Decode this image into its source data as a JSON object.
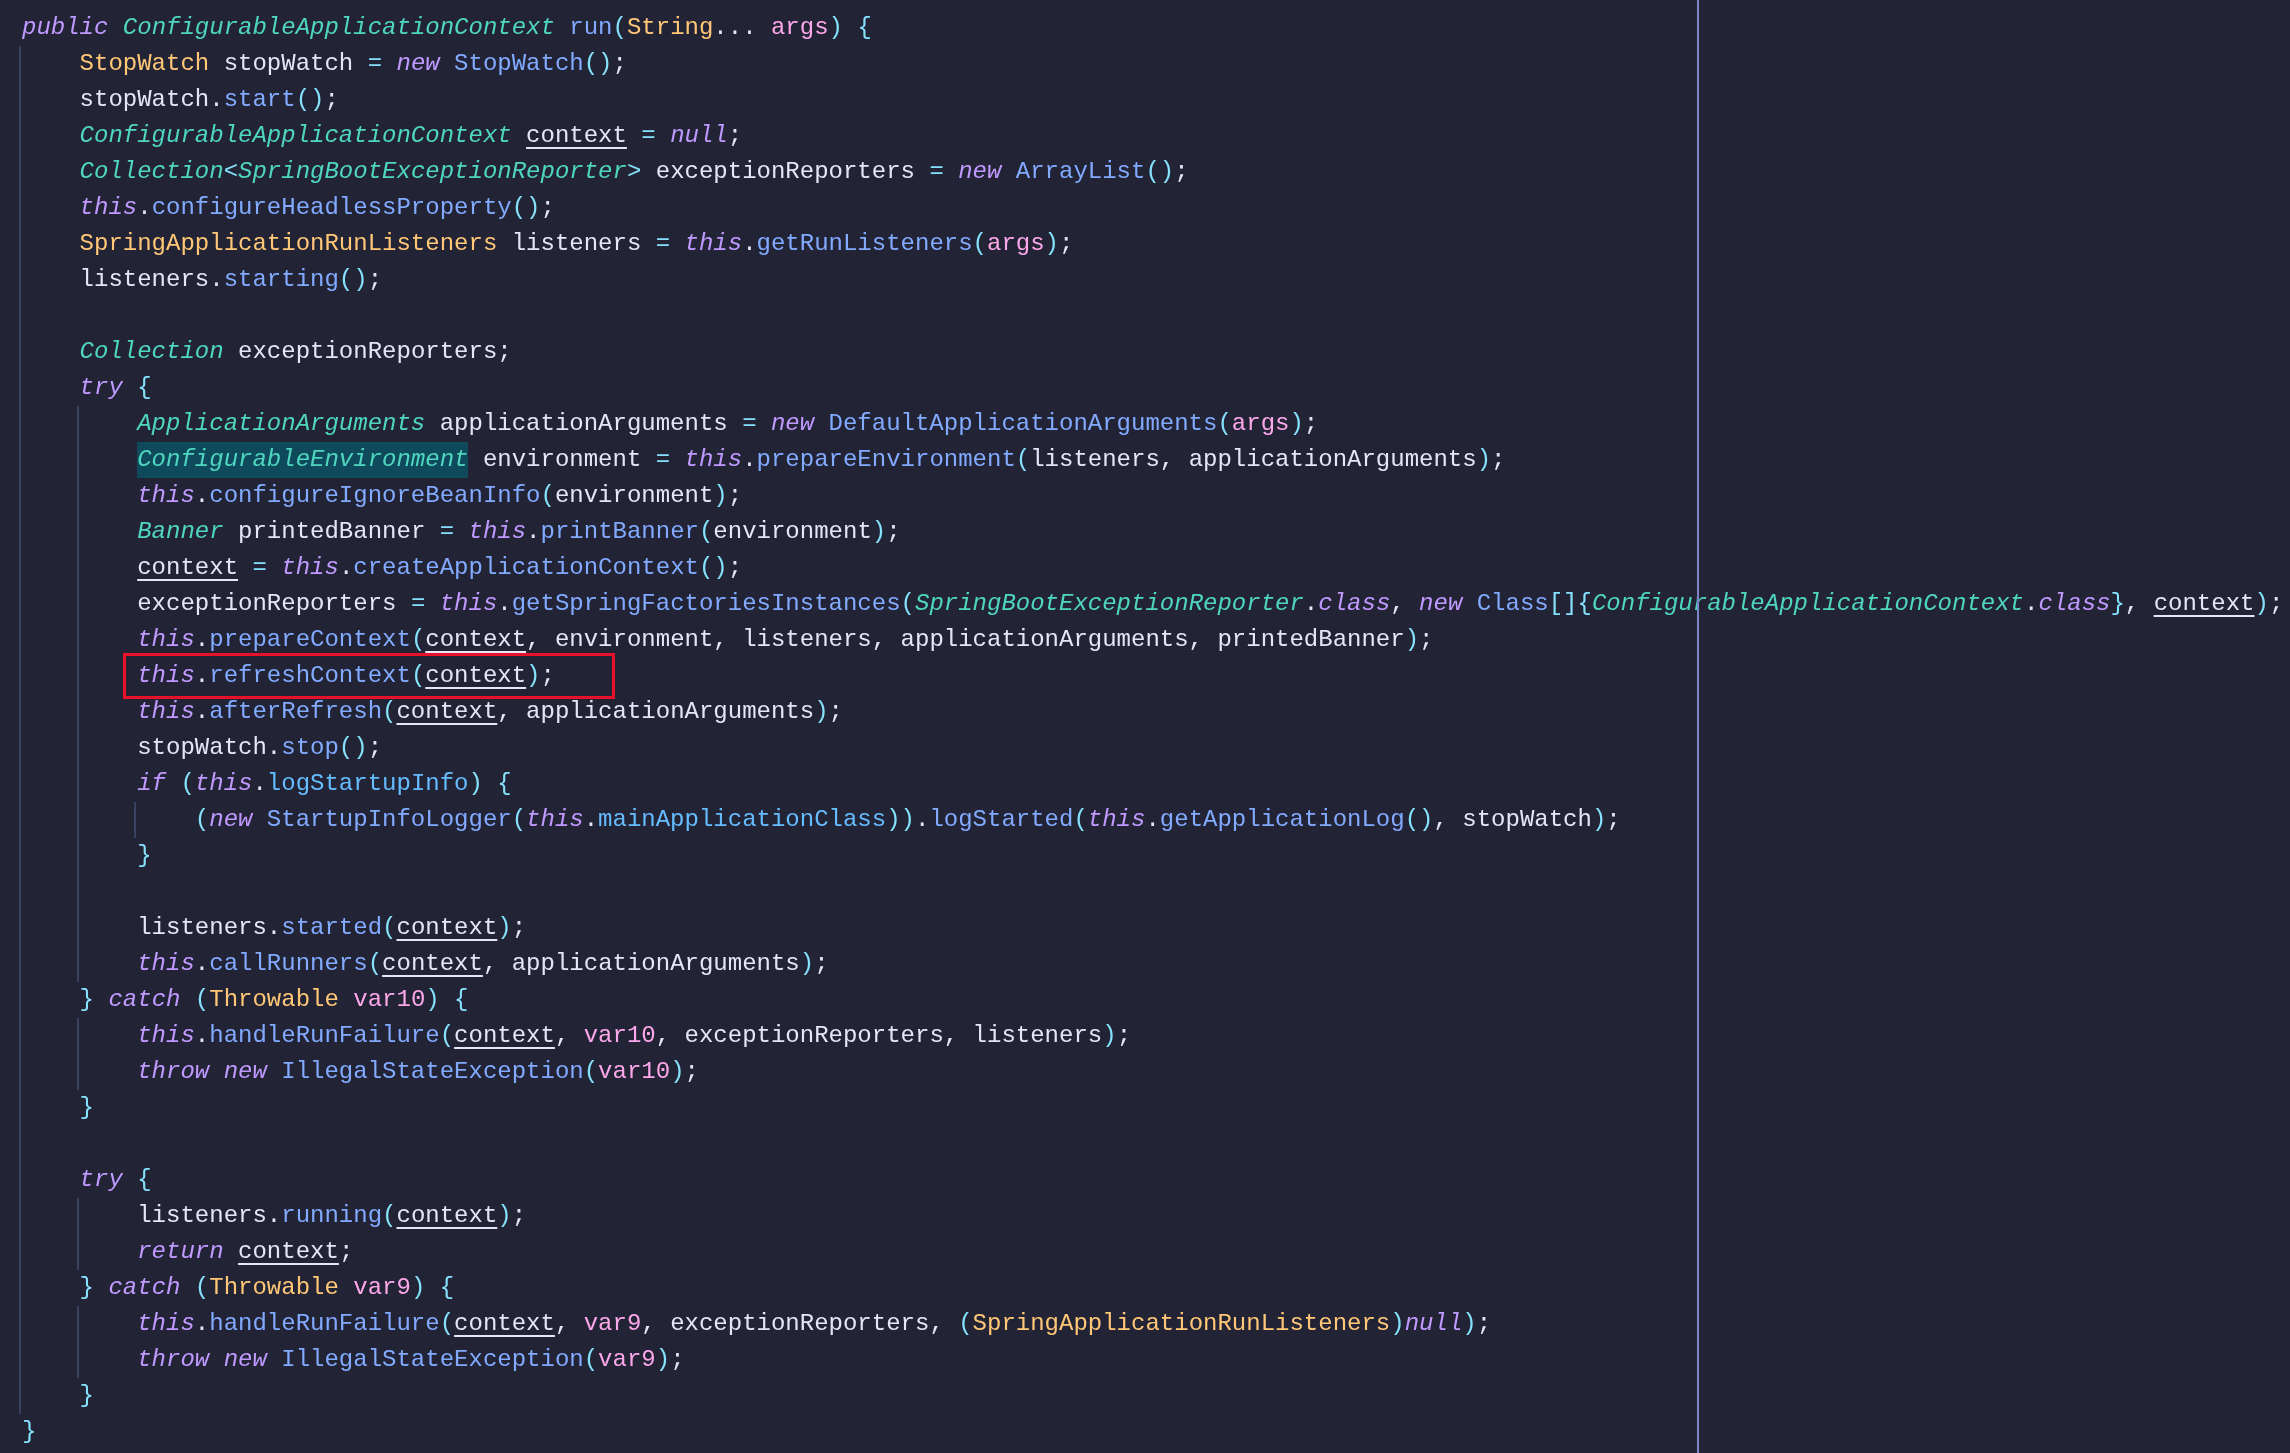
{
  "editor": {
    "lines": [
      {
        "kind": "code",
        "highlighted": false,
        "tokens": [
          {
            "text": "public ",
            "kind": "kw"
          },
          {
            "text": "ConfigurableApplicationContext ",
            "kind": "itype"
          },
          {
            "text": "run",
            "kind": "call"
          },
          {
            "text": "(",
            "kind": "op"
          },
          {
            "text": "String",
            "kind": "type"
          },
          {
            "text": "... ",
            "kind": "p"
          },
          {
            "text": "args",
            "kind": "param"
          },
          {
            "text": ") {",
            "kind": "op"
          }
        ],
        "children": [
          {
            "kind": "code",
            "highlighted": false,
            "tokens": [
              {
                "text": "StopWatch",
                "kind": "type"
              },
              {
                "text": " stopWatch ",
                "kind": "id"
              },
              {
                "text": "= ",
                "kind": "op"
              },
              {
                "text": "new ",
                "kind": "kw"
              },
              {
                "text": "StopWatch",
                "kind": "call"
              },
              {
                "text": "()",
                "kind": "op"
              },
              {
                "text": ";",
                "kind": "p"
              }
            ]
          },
          {
            "kind": "code",
            "highlighted": false,
            "tokens": [
              {
                "text": "stopWatch.",
                "kind": "id"
              },
              {
                "text": "start",
                "kind": "call"
              },
              {
                "text": "()",
                "kind": "op"
              },
              {
                "text": ";",
                "kind": "p"
              }
            ]
          },
          {
            "kind": "code",
            "highlighted": false,
            "tokens": [
              {
                "text": "ConfigurableApplicationContext ",
                "kind": "itype"
              },
              {
                "text": "context",
                "kind": "var"
              },
              {
                "text": " = ",
                "kind": "op"
              },
              {
                "text": "null",
                "kind": "kw"
              },
              {
                "text": ";",
                "kind": "p"
              }
            ]
          },
          {
            "kind": "code",
            "highlighted": false,
            "tokens": [
              {
                "text": "Collection",
                "kind": "itype"
              },
              {
                "text": "<",
                "kind": "op"
              },
              {
                "text": "SpringBootExceptionReporter",
                "kind": "itype"
              },
              {
                "text": ">",
                "kind": "op"
              },
              {
                "text": " exceptionReporters ",
                "kind": "id"
              },
              {
                "text": "= ",
                "kind": "op"
              },
              {
                "text": "new ",
                "kind": "kw"
              },
              {
                "text": "ArrayList",
                "kind": "call"
              },
              {
                "text": "()",
                "kind": "op"
              },
              {
                "text": ";",
                "kind": "p"
              }
            ]
          },
          {
            "kind": "code",
            "highlighted": false,
            "tokens": [
              {
                "text": "this",
                "kind": "kw"
              },
              {
                "text": ".",
                "kind": "p"
              },
              {
                "text": "configureHeadlessProperty",
                "kind": "call"
              },
              {
                "text": "()",
                "kind": "op"
              },
              {
                "text": ";",
                "kind": "p"
              }
            ]
          },
          {
            "kind": "code",
            "highlighted": false,
            "tokens": [
              {
                "text": "SpringApplicationRunListeners",
                "kind": "type"
              },
              {
                "text": " listeners ",
                "kind": "id"
              },
              {
                "text": "= ",
                "kind": "op"
              },
              {
                "text": "this",
                "kind": "kw"
              },
              {
                "text": ".",
                "kind": "p"
              },
              {
                "text": "getRunListeners",
                "kind": "call"
              },
              {
                "text": "(",
                "kind": "op"
              },
              {
                "text": "args",
                "kind": "param"
              },
              {
                "text": ")",
                "kind": "op"
              },
              {
                "text": ";",
                "kind": "p"
              }
            ]
          },
          {
            "kind": "code",
            "highlighted": false,
            "tokens": [
              {
                "text": "listeners.",
                "kind": "id"
              },
              {
                "text": "starting",
                "kind": "call"
              },
              {
                "text": "()",
                "kind": "op"
              },
              {
                "text": ";",
                "kind": "p"
              }
            ]
          },
          {
            "kind": "blank"
          },
          {
            "kind": "code",
            "highlighted": false,
            "tokens": [
              {
                "text": "Collection ",
                "kind": "itype"
              },
              {
                "text": "exceptionReporters;",
                "kind": "id"
              }
            ]
          },
          {
            "kind": "code",
            "highlighted": false,
            "tokens": [
              {
                "text": "try ",
                "kind": "kw"
              },
              {
                "text": "{",
                "kind": "op"
              }
            ],
            "children": [
              {
                "kind": "code",
                "highlighted": false,
                "tokens": [
                  {
                    "text": "ApplicationArguments ",
                    "kind": "itype"
                  },
                  {
                    "text": "applicationArguments ",
                    "kind": "id"
                  },
                  {
                    "text": "= ",
                    "kind": "op"
                  },
                  {
                    "text": "new ",
                    "kind": "kw"
                  },
                  {
                    "text": "DefaultApplicationArguments",
                    "kind": "call"
                  },
                  {
                    "text": "(",
                    "kind": "op"
                  },
                  {
                    "text": "args",
                    "kind": "param"
                  },
                  {
                    "text": ")",
                    "kind": "op"
                  },
                  {
                    "text": ";",
                    "kind": "p"
                  }
                ]
              },
              {
                "kind": "code",
                "highlighted": false,
                "tokens": [
                  {
                    "text": "ConfigurableEnvironment",
                    "kind": "sel"
                  },
                  {
                    "text": " environment ",
                    "kind": "id"
                  },
                  {
                    "text": "= ",
                    "kind": "op"
                  },
                  {
                    "text": "this",
                    "kind": "kw"
                  },
                  {
                    "text": ".",
                    "kind": "p"
                  },
                  {
                    "text": "prepareEnvironment",
                    "kind": "call"
                  },
                  {
                    "text": "(",
                    "kind": "op"
                  },
                  {
                    "text": "listeners, applicationArguments",
                    "kind": "id"
                  },
                  {
                    "text": ")",
                    "kind": "op"
                  },
                  {
                    "text": ";",
                    "kind": "p"
                  }
                ]
              },
              {
                "kind": "code",
                "highlighted": false,
                "tokens": [
                  {
                    "text": "this",
                    "kind": "kw"
                  },
                  {
                    "text": ".",
                    "kind": "p"
                  },
                  {
                    "text": "configureIgnoreBeanInfo",
                    "kind": "call"
                  },
                  {
                    "text": "(",
                    "kind": "op"
                  },
                  {
                    "text": "environment",
                    "kind": "id"
                  },
                  {
                    "text": ")",
                    "kind": "op"
                  },
                  {
                    "text": ";",
                    "kind": "p"
                  }
                ]
              },
              {
                "kind": "code",
                "highlighted": false,
                "tokens": [
                  {
                    "text": "Banner ",
                    "kind": "itype"
                  },
                  {
                    "text": "printedBanner ",
                    "kind": "id"
                  },
                  {
                    "text": "= ",
                    "kind": "op"
                  },
                  {
                    "text": "this",
                    "kind": "kw"
                  },
                  {
                    "text": ".",
                    "kind": "p"
                  },
                  {
                    "text": "printBanner",
                    "kind": "call"
                  },
                  {
                    "text": "(",
                    "kind": "op"
                  },
                  {
                    "text": "environment",
                    "kind": "id"
                  },
                  {
                    "text": ")",
                    "kind": "op"
                  },
                  {
                    "text": ";",
                    "kind": "p"
                  }
                ]
              },
              {
                "kind": "code",
                "highlighted": false,
                "tokens": [
                  {
                    "text": "context",
                    "kind": "var"
                  },
                  {
                    "text": " = ",
                    "kind": "op"
                  },
                  {
                    "text": "this",
                    "kind": "kw"
                  },
                  {
                    "text": ".",
                    "kind": "p"
                  },
                  {
                    "text": "createApplicationContext",
                    "kind": "call"
                  },
                  {
                    "text": "()",
                    "kind": "op"
                  },
                  {
                    "text": ";",
                    "kind": "p"
                  }
                ]
              },
              {
                "kind": "code",
                "highlighted": false,
                "tokens": [
                  {
                    "text": "exceptionReporters ",
                    "kind": "id"
                  },
                  {
                    "text": "= ",
                    "kind": "op"
                  },
                  {
                    "text": "this",
                    "kind": "kw"
                  },
                  {
                    "text": ".",
                    "kind": "p"
                  },
                  {
                    "text": "getSpringFactoriesInstances",
                    "kind": "call"
                  },
                  {
                    "text": "(",
                    "kind": "op"
                  },
                  {
                    "text": "SpringBootExceptionReporter",
                    "kind": "itype"
                  },
                  {
                    "text": ".",
                    "kind": "p"
                  },
                  {
                    "text": "class",
                    "kind": "kw"
                  },
                  {
                    "text": ", ",
                    "kind": "p"
                  },
                  {
                    "text": "new ",
                    "kind": "kw"
                  },
                  {
                    "text": "Class",
                    "kind": "call"
                  },
                  {
                    "text": "[]{",
                    "kind": "op"
                  },
                  {
                    "text": "ConfigurableApplicationContext",
                    "kind": "itype"
                  },
                  {
                    "text": ".",
                    "kind": "p"
                  },
                  {
                    "text": "class",
                    "kind": "kw"
                  },
                  {
                    "text": "}",
                    "kind": "op"
                  },
                  {
                    "text": ", ",
                    "kind": "p"
                  },
                  {
                    "text": "context",
                    "kind": "var"
                  },
                  {
                    "text": ")",
                    "kind": "op"
                  },
                  {
                    "text": ";",
                    "kind": "p"
                  }
                ]
              },
              {
                "kind": "code",
                "highlighted": false,
                "tokens": [
                  {
                    "text": "this",
                    "kind": "kw"
                  },
                  {
                    "text": ".",
                    "kind": "p"
                  },
                  {
                    "text": "prepareContext",
                    "kind": "call"
                  },
                  {
                    "text": "(",
                    "kind": "op"
                  },
                  {
                    "text": "context",
                    "kind": "var"
                  },
                  {
                    "text": ", environment, listeners, applicationArguments, printedBanner",
                    "kind": "id"
                  },
                  {
                    "text": ")",
                    "kind": "op"
                  },
                  {
                    "text": ";",
                    "kind": "p"
                  }
                ]
              },
              {
                "kind": "code",
                "highlighted": true,
                "tokens": [
                  {
                    "text": "this",
                    "kind": "kw"
                  },
                  {
                    "text": ".",
                    "kind": "p"
                  },
                  {
                    "text": "refreshContext",
                    "kind": "call"
                  },
                  {
                    "text": "(",
                    "kind": "op"
                  },
                  {
                    "text": "context",
                    "kind": "var"
                  },
                  {
                    "text": ")",
                    "kind": "op"
                  },
                  {
                    "text": ";",
                    "kind": "p"
                  }
                ]
              },
              {
                "kind": "code",
                "highlighted": false,
                "tokens": [
                  {
                    "text": "this",
                    "kind": "kw"
                  },
                  {
                    "text": ".",
                    "kind": "p"
                  },
                  {
                    "text": "afterRefresh",
                    "kind": "call"
                  },
                  {
                    "text": "(",
                    "kind": "op"
                  },
                  {
                    "text": "context",
                    "kind": "var"
                  },
                  {
                    "text": ", applicationArguments",
                    "kind": "id"
                  },
                  {
                    "text": ")",
                    "kind": "op"
                  },
                  {
                    "text": ";",
                    "kind": "p"
                  }
                ]
              },
              {
                "kind": "code",
                "highlighted": false,
                "tokens": [
                  {
                    "text": "stopWatch.",
                    "kind": "id"
                  },
                  {
                    "text": "stop",
                    "kind": "call"
                  },
                  {
                    "text": "()",
                    "kind": "op"
                  },
                  {
                    "text": ";",
                    "kind": "p"
                  }
                ]
              },
              {
                "kind": "code",
                "highlighted": false,
                "tokens": [
                  {
                    "text": "if ",
                    "kind": "kw"
                  },
                  {
                    "text": "(",
                    "kind": "op"
                  },
                  {
                    "text": "this",
                    "kind": "kw"
                  },
                  {
                    "text": ".",
                    "kind": "p"
                  },
                  {
                    "text": "logStartupInfo",
                    "kind": "field"
                  },
                  {
                    "text": ") {",
                    "kind": "op"
                  }
                ],
                "children": [
                  {
                    "kind": "code",
                    "highlighted": false,
                    "tokens": [
                      {
                        "text": "(",
                        "kind": "op"
                      },
                      {
                        "text": "new ",
                        "kind": "kw"
                      },
                      {
                        "text": "StartupInfoLogger",
                        "kind": "call"
                      },
                      {
                        "text": "(",
                        "kind": "op"
                      },
                      {
                        "text": "this",
                        "kind": "kw"
                      },
                      {
                        "text": ".",
                        "kind": "p"
                      },
                      {
                        "text": "mainApplicationClass",
                        "kind": "field"
                      },
                      {
                        "text": "))",
                        "kind": "op"
                      },
                      {
                        "text": ".",
                        "kind": "p"
                      },
                      {
                        "text": "logStarted",
                        "kind": "call"
                      },
                      {
                        "text": "(",
                        "kind": "op"
                      },
                      {
                        "text": "this",
                        "kind": "kw"
                      },
                      {
                        "text": ".",
                        "kind": "p"
                      },
                      {
                        "text": "getApplicationLog",
                        "kind": "call"
                      },
                      {
                        "text": "()",
                        "kind": "op"
                      },
                      {
                        "text": ", stopWatch",
                        "kind": "id"
                      },
                      {
                        "text": ")",
                        "kind": "op"
                      },
                      {
                        "text": ";",
                        "kind": "p"
                      }
                    ]
                  }
                ]
              },
              {
                "kind": "code",
                "highlighted": false,
                "tokens": [
                  {
                    "text": "}",
                    "kind": "op"
                  }
                ]
              },
              {
                "kind": "blank"
              },
              {
                "kind": "code",
                "highlighted": false,
                "tokens": [
                  {
                    "text": "listeners.",
                    "kind": "id"
                  },
                  {
                    "text": "started",
                    "kind": "call"
                  },
                  {
                    "text": "(",
                    "kind": "op"
                  },
                  {
                    "text": "context",
                    "kind": "var"
                  },
                  {
                    "text": ")",
                    "kind": "op"
                  },
                  {
                    "text": ";",
                    "kind": "p"
                  }
                ]
              },
              {
                "kind": "code",
                "highlighted": false,
                "tokens": [
                  {
                    "text": "this",
                    "kind": "kw"
                  },
                  {
                    "text": ".",
                    "kind": "p"
                  },
                  {
                    "text": "callRunners",
                    "kind": "call"
                  },
                  {
                    "text": "(",
                    "kind": "op"
                  },
                  {
                    "text": "context",
                    "kind": "var"
                  },
                  {
                    "text": ", applicationArguments",
                    "kind": "id"
                  },
                  {
                    "text": ")",
                    "kind": "op"
                  },
                  {
                    "text": ";",
                    "kind": "p"
                  }
                ]
              }
            ]
          },
          {
            "kind": "code",
            "highlighted": false,
            "tokens": [
              {
                "text": "} ",
                "kind": "op"
              },
              {
                "text": "catch ",
                "kind": "kw"
              },
              {
                "text": "(",
                "kind": "op"
              },
              {
                "text": "Throwable ",
                "kind": "type"
              },
              {
                "text": "var10",
                "kind": "param"
              },
              {
                "text": ") {",
                "kind": "op"
              }
            ],
            "children": [
              {
                "kind": "code",
                "highlighted": false,
                "tokens": [
                  {
                    "text": "this",
                    "kind": "kw"
                  },
                  {
                    "text": ".",
                    "kind": "p"
                  },
                  {
                    "text": "handleRunFailure",
                    "kind": "call"
                  },
                  {
                    "text": "(",
                    "kind": "op"
                  },
                  {
                    "text": "context",
                    "kind": "var"
                  },
                  {
                    "text": ", ",
                    "kind": "p"
                  },
                  {
                    "text": "var10",
                    "kind": "param"
                  },
                  {
                    "text": ", exceptionReporters, listeners",
                    "kind": "id"
                  },
                  {
                    "text": ")",
                    "kind": "op"
                  },
                  {
                    "text": ";",
                    "kind": "p"
                  }
                ]
              },
              {
                "kind": "code",
                "highlighted": false,
                "tokens": [
                  {
                    "text": "throw new ",
                    "kind": "kw"
                  },
                  {
                    "text": "IllegalStateException",
                    "kind": "call"
                  },
                  {
                    "text": "(",
                    "kind": "op"
                  },
                  {
                    "text": "var10",
                    "kind": "param"
                  },
                  {
                    "text": ")",
                    "kind": "op"
                  },
                  {
                    "text": ";",
                    "kind": "p"
                  }
                ]
              }
            ]
          },
          {
            "kind": "code",
            "highlighted": false,
            "tokens": [
              {
                "text": "}",
                "kind": "op"
              }
            ]
          },
          {
            "kind": "blank"
          },
          {
            "kind": "code",
            "highlighted": false,
            "tokens": [
              {
                "text": "try ",
                "kind": "kw"
              },
              {
                "text": "{",
                "kind": "op"
              }
            ],
            "children": [
              {
                "kind": "code",
                "highlighted": false,
                "tokens": [
                  {
                    "text": "listeners.",
                    "kind": "id"
                  },
                  {
                    "text": "running",
                    "kind": "call"
                  },
                  {
                    "text": "(",
                    "kind": "op"
                  },
                  {
                    "text": "context",
                    "kind": "var"
                  },
                  {
                    "text": ")",
                    "kind": "op"
                  },
                  {
                    "text": ";",
                    "kind": "p"
                  }
                ]
              },
              {
                "kind": "code",
                "highlighted": false,
                "tokens": [
                  {
                    "text": "return ",
                    "kind": "kw"
                  },
                  {
                    "text": "context",
                    "kind": "var"
                  },
                  {
                    "text": ";",
                    "kind": "p"
                  }
                ]
              }
            ]
          },
          {
            "kind": "code",
            "highlighted": false,
            "tokens": [
              {
                "text": "} ",
                "kind": "op"
              },
              {
                "text": "catch ",
                "kind": "kw"
              },
              {
                "text": "(",
                "kind": "op"
              },
              {
                "text": "Throwable ",
                "kind": "type"
              },
              {
                "text": "var9",
                "kind": "param"
              },
              {
                "text": ") {",
                "kind": "op"
              }
            ],
            "children": [
              {
                "kind": "code",
                "highlighted": false,
                "tokens": [
                  {
                    "text": "this",
                    "kind": "kw"
                  },
                  {
                    "text": ".",
                    "kind": "p"
                  },
                  {
                    "text": "handleRunFailure",
                    "kind": "call"
                  },
                  {
                    "text": "(",
                    "kind": "op"
                  },
                  {
                    "text": "context",
                    "kind": "var"
                  },
                  {
                    "text": ", ",
                    "kind": "p"
                  },
                  {
                    "text": "var9",
                    "kind": "param"
                  },
                  {
                    "text": ", exceptionReporters, ",
                    "kind": "id"
                  },
                  {
                    "text": "(",
                    "kind": "op"
                  },
                  {
                    "text": "SpringApplicationRunListeners",
                    "kind": "type"
                  },
                  {
                    "text": ")",
                    "kind": "op"
                  },
                  {
                    "text": "null",
                    "kind": "kw"
                  },
                  {
                    "text": ")",
                    "kind": "op"
                  },
                  {
                    "text": ";",
                    "kind": "p"
                  }
                ]
              },
              {
                "kind": "code",
                "highlighted": false,
                "tokens": [
                  {
                    "text": "throw new ",
                    "kind": "kw"
                  },
                  {
                    "text": "IllegalStateException",
                    "kind": "call"
                  },
                  {
                    "text": "(",
                    "kind": "op"
                  },
                  {
                    "text": "var9",
                    "kind": "param"
                  },
                  {
                    "text": ")",
                    "kind": "op"
                  },
                  {
                    "text": ";",
                    "kind": "p"
                  }
                ]
              }
            ]
          },
          {
            "kind": "code",
            "highlighted": false,
            "tokens": [
              {
                "text": "}",
                "kind": "op"
              }
            ]
          }
        ]
      },
      {
        "kind": "code",
        "highlighted": false,
        "tokens": [
          {
            "text": "}",
            "kind": "op"
          }
        ]
      }
    ]
  }
}
